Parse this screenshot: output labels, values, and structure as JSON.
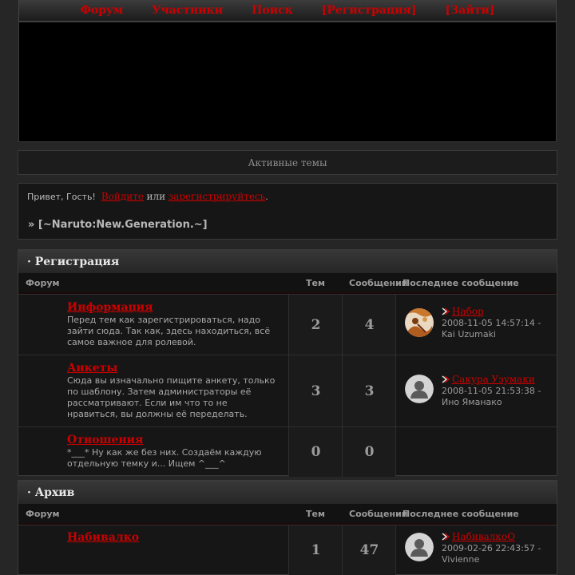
{
  "nav": {
    "items": [
      "Форум",
      "Участники",
      "Поиск",
      "[Регистрация]",
      "[Зайти]"
    ]
  },
  "active_topics": "Активные темы",
  "greeting": {
    "prefix": "Привет, Гость!",
    "login": "Войдите",
    "or": "или",
    "register": "зарегистрируйтесь",
    "suffix": ".",
    "board_path": "» [~Naruto:New.Generation.~]"
  },
  "columns": {
    "forum": "Форум",
    "topics": "Тем",
    "posts": "Сообщений",
    "last": "Последнее сообщение"
  },
  "categories": [
    {
      "title": "· Регистрация",
      "forums": [
        {
          "title": "Информация",
          "desc": "Перед тем как зарегистрироваться, надо зайти сюда. Так как, здесь находиться, всё самое важное для ролевой.",
          "topics": "2",
          "posts": "4",
          "last_topic": "Набор",
          "last_time": "2008-11-05 14:57:14 -",
          "last_user": "Kai Uzumaki",
          "avatar": "photo"
        },
        {
          "title": "Анкеты",
          "desc": "Сюда вы изначально пищите анкету, только по шаблону. Затем администраторы её рассматривают. Если им что то не нравиться, вы должны её переделать.",
          "topics": "3",
          "posts": "3",
          "last_topic": "Сакура Узумаки",
          "last_time": "2008-11-05 21:53:38 -",
          "last_user": "Ино Яманако",
          "avatar": "default"
        },
        {
          "title": "Отношения",
          "desc": "*___* Ну как же без них. Создаём каждую отдельную темку и... Ищем ^___^",
          "topics": "0",
          "posts": "0"
        }
      ]
    },
    {
      "title": "· Архив",
      "forums": [
        {
          "title": "Набивалко",
          "topics": "1",
          "posts": "47",
          "last_topic": "НабивалкоО",
          "last_time": "2009-02-26 22:43:57 -",
          "last_user": "Vivienne",
          "avatar": "default"
        }
      ]
    }
  ],
  "colors": {
    "accent": "#cc0000",
    "background": "#262626",
    "panel": "#161616"
  }
}
